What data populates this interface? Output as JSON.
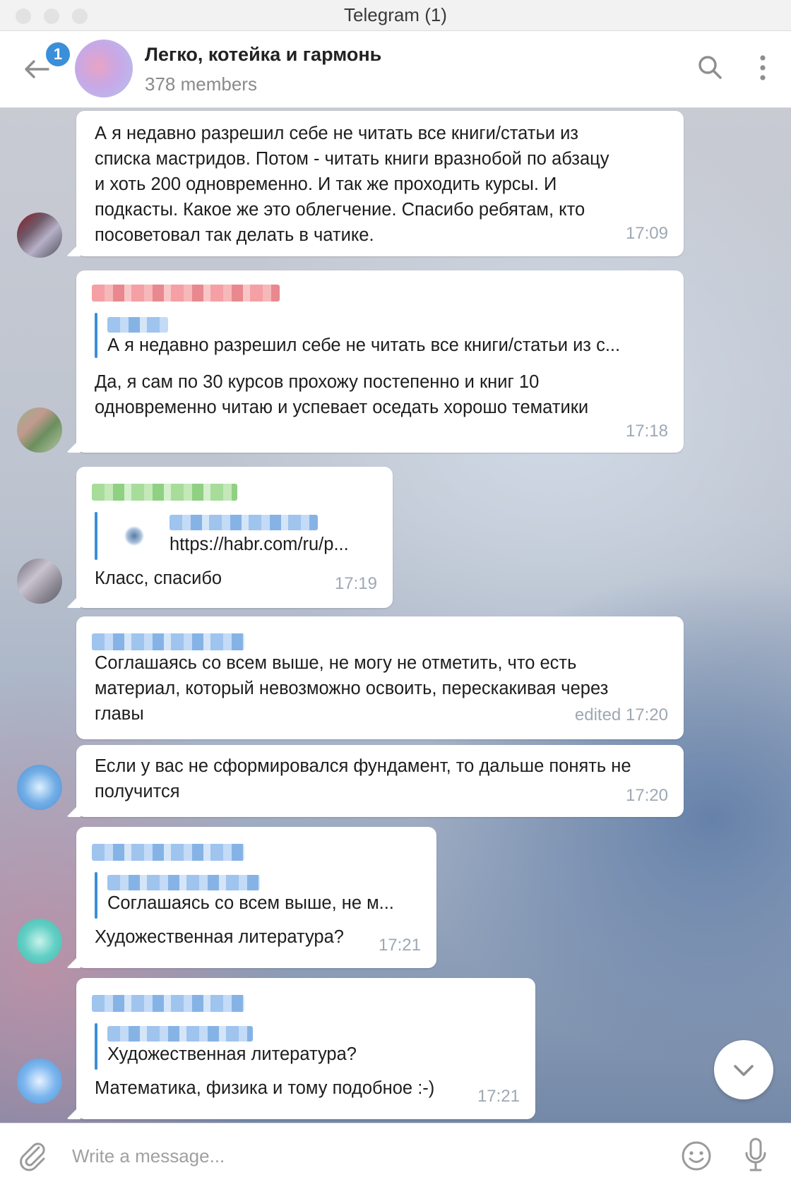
{
  "window": {
    "title": "Telegram (1)"
  },
  "header": {
    "unread_count": "1",
    "group_name": "Легко, котейка и гармонь",
    "members": "378 members"
  },
  "messages": [
    {
      "text": "А я недавно разрешил себе не читать все книги/статьи из\nсписка  мастридов. Потом - читать книги вразнобой по абзацу\nи хоть 200 одновременно. И так же проходить курсы. И\nподкасты. Какое же это облегчение. Спасибо ребятам, кто\nпосоветовал так делать в чатике.",
      "time": "17:09"
    },
    {
      "reply_text": "А я недавно разрешил себе не читать все книги/статьи из с...",
      "text": "Да, я сам по 30 курсов прохожу постепенно и книг 10\nодновременно читаю и успевает оседать хорошо тематики",
      "time": "17:18"
    },
    {
      "link_preview": "https://habr.com/ru/p...",
      "text": "Класс, спасибо",
      "time": "17:19"
    },
    {
      "text": "Соглашаясь со всем выше, не могу не отметить, что есть\nматериал, который невозможно освоить, перескакивая через\nглавы",
      "time": "edited 17:20"
    },
    {
      "text": "Если у вас не сформировался фундамент, то дальше понять не\nполучится",
      "time": "17:20"
    },
    {
      "reply_text": "Соглашаясь со всем выше, не м...",
      "text": "Художественная литература?",
      "time": "17:21"
    },
    {
      "reply_text": "Художественная литература?",
      "text": "Математика, физика и тому подобное :-)",
      "time": "17:21"
    }
  ],
  "composer": {
    "placeholder": "Write a message..."
  },
  "icons": {
    "back": "arrow-left-icon",
    "search": "search-icon",
    "more": "more-vertical-icon",
    "attach": "paperclip-icon",
    "emoji": "emoji-icon",
    "mic": "microphone-icon",
    "scroll": "chevron-down-icon"
  },
  "colors": {
    "accent": "#3a8fd8",
    "time": "#9ea8b3"
  }
}
